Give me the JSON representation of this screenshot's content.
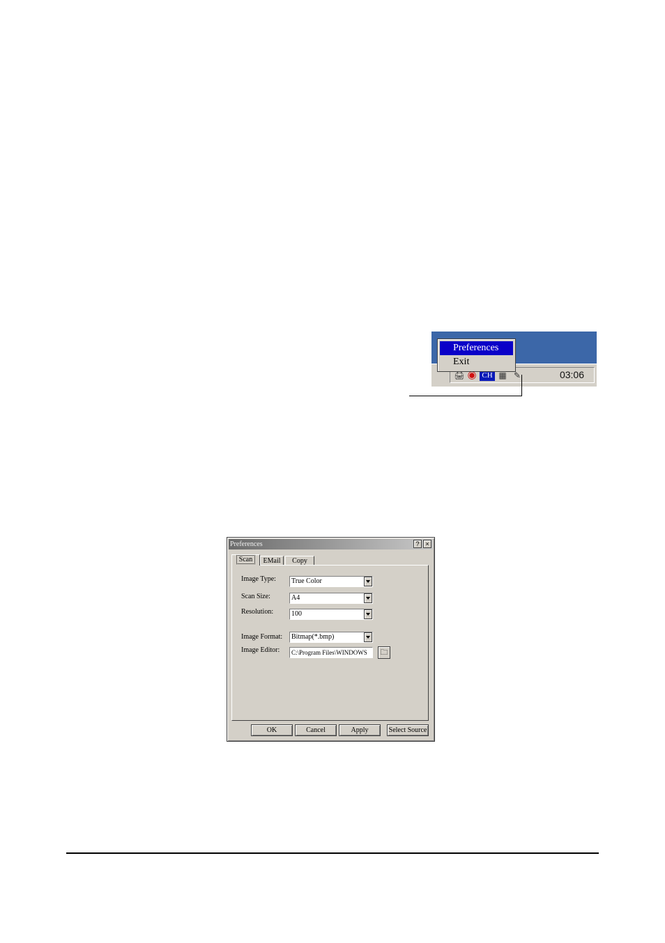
{
  "context_menu": {
    "items": [
      {
        "label": "Preferences",
        "selected": true
      },
      {
        "label": "Exit",
        "selected": false
      }
    ]
  },
  "taskbar": {
    "clock": "03:06",
    "tray_icons": [
      "scanner-app-icon",
      "lifebuoy-icon",
      "input-method-icon",
      "network-icon",
      "scanner-tray-icon"
    ],
    "input_method_label": "CH",
    "colors": {
      "desktop": "#3c67a8",
      "menu_highlight": "#0a00c8",
      "taskbar": "#d4d0c8"
    }
  },
  "dialog": {
    "title": "Preferences",
    "help_glyph": "?",
    "close_glyph": "×",
    "tabs": [
      {
        "label": "Scan",
        "active": true
      },
      {
        "label": "EMail",
        "active": false
      },
      {
        "label": "Copy",
        "active": false
      }
    ],
    "fields": {
      "image_type": {
        "label": "Image Type:",
        "value": "True Color"
      },
      "scan_size": {
        "label": "Scan Size:",
        "value": "A4"
      },
      "resolution": {
        "label": "Resolution:",
        "value": "100"
      },
      "image_format": {
        "label": "Image Format:",
        "value": "Bitmap(*.bmp)"
      },
      "image_editor": {
        "label": "Image Editor:",
        "value": "C:\\Program Files\\WINDOWS"
      }
    },
    "buttons": {
      "ok": "OK",
      "cancel": "Cancel",
      "apply": "Apply",
      "select_source": "Select Source"
    }
  }
}
